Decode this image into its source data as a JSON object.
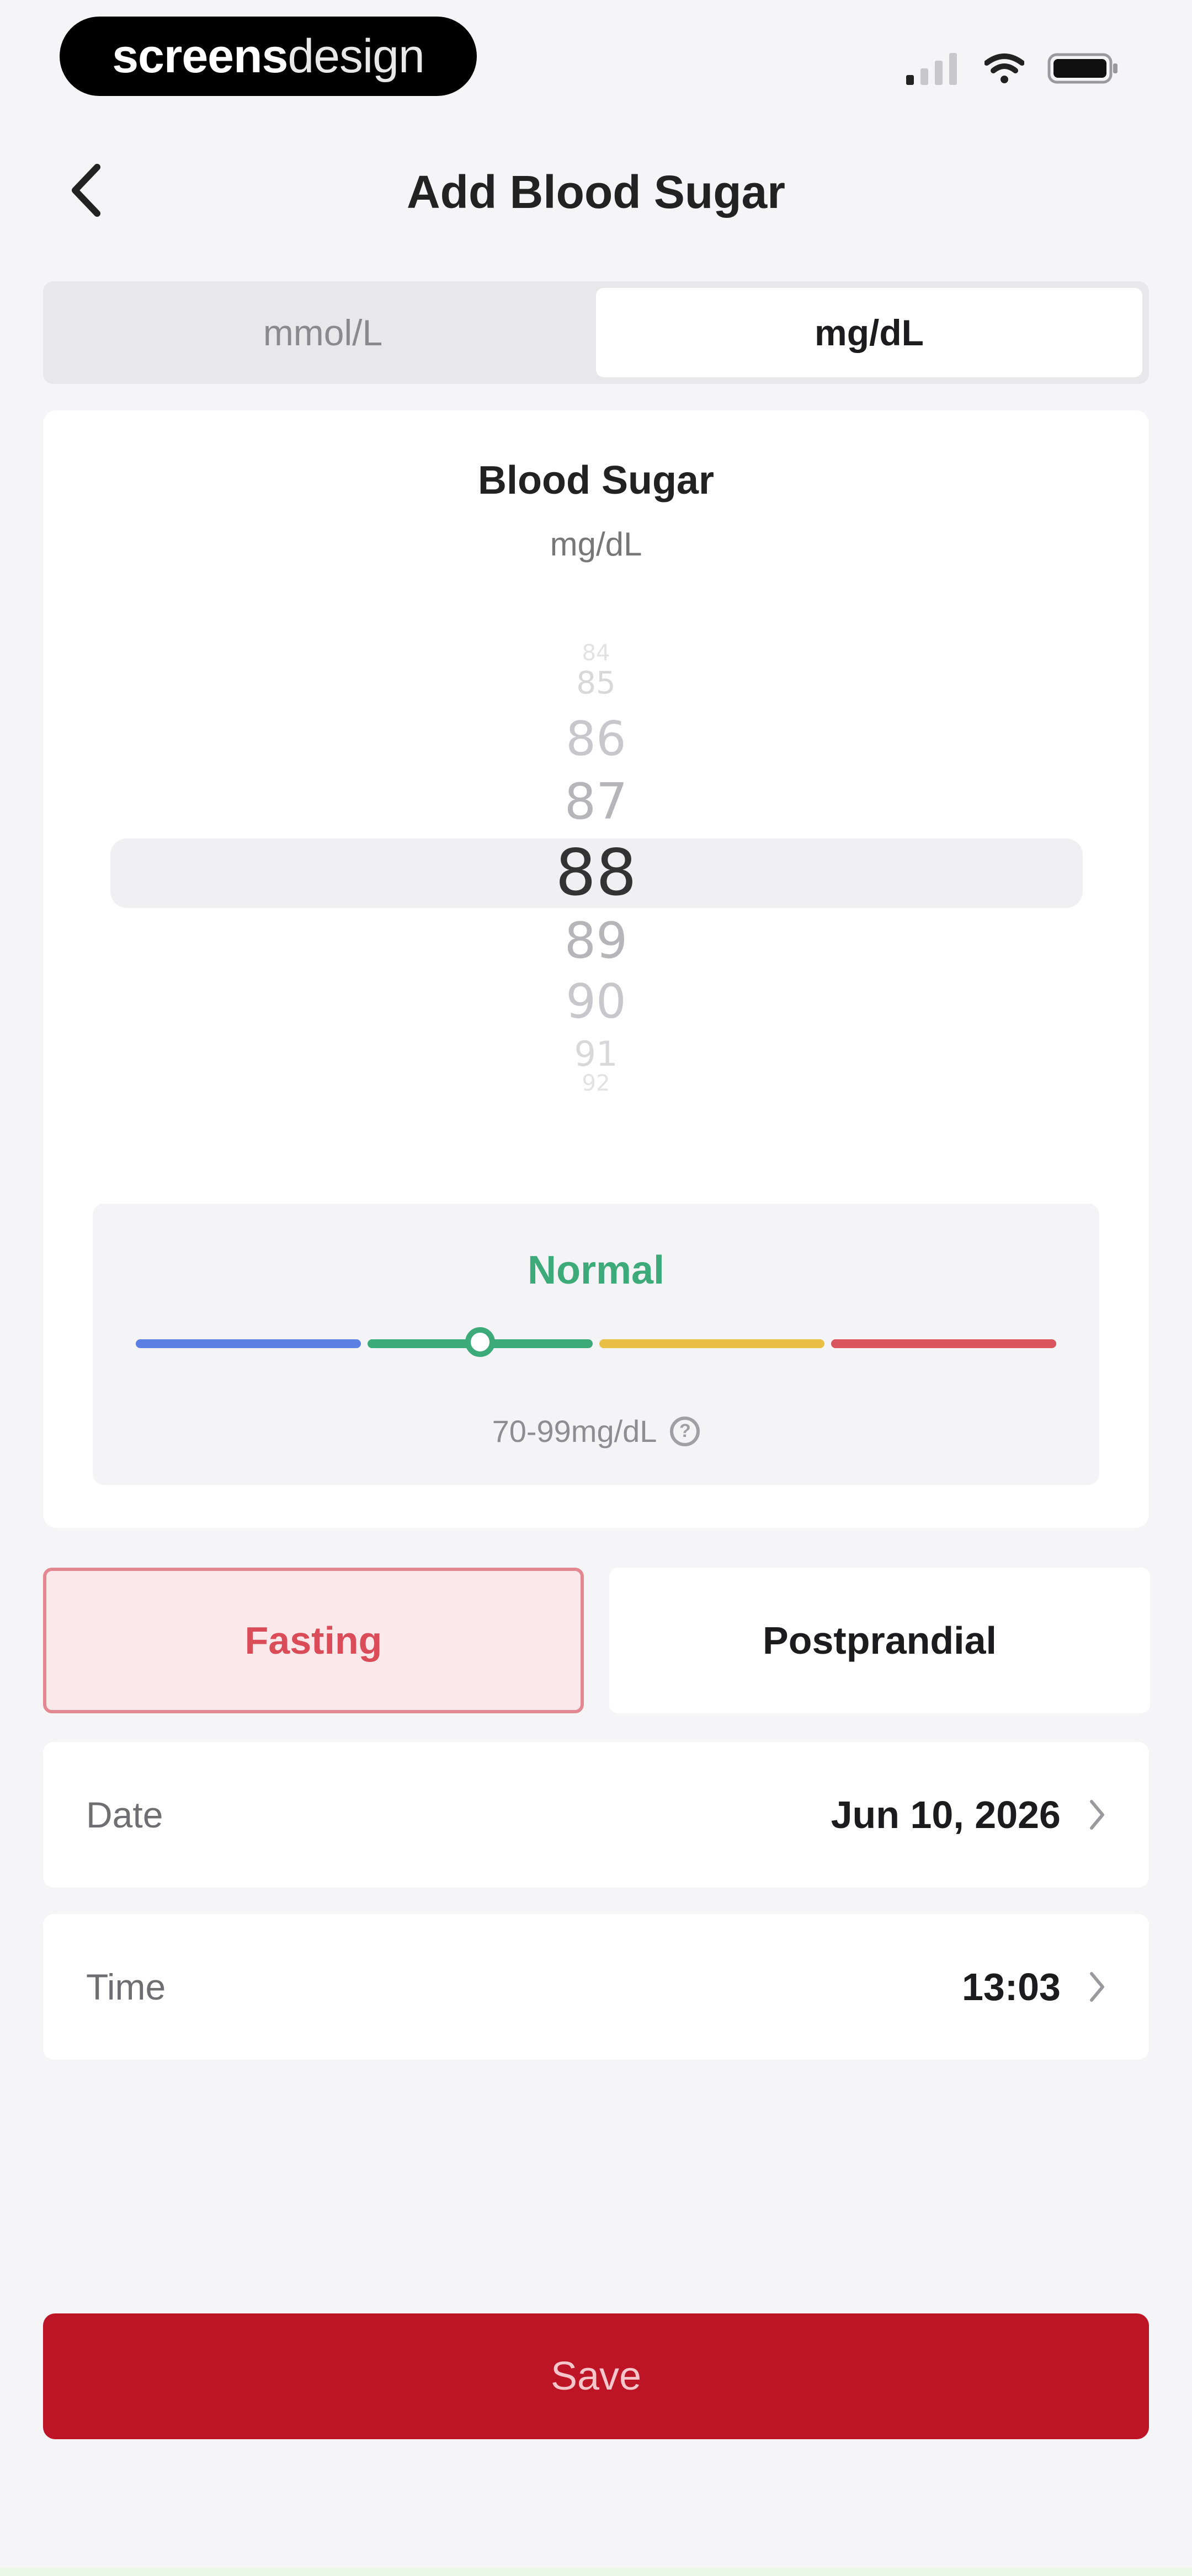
{
  "status_bar": {
    "brand_bold": "screens",
    "brand_light": "design",
    "icons": [
      "signal-icon",
      "wifi-icon",
      "battery-icon"
    ]
  },
  "nav": {
    "back_icon": "chevron-left-icon",
    "title": "Add Blood Sugar"
  },
  "unit_toggle": {
    "options": [
      "mmol/L",
      "mg/dL"
    ],
    "selected": "mg/dL"
  },
  "picker": {
    "title": "Blood Sugar",
    "unit": "mg/dL",
    "values_above": [
      "84",
      "85",
      "86",
      "87"
    ],
    "selected": "88",
    "values_below": [
      "89",
      "90",
      "91",
      "92"
    ]
  },
  "status": {
    "label": "Normal",
    "range": "70-99mg/dL",
    "info_icon": "info-icon",
    "scale_colors": [
      "#5b7fe3",
      "#3daa7a",
      "#e9bf45",
      "#d9545c"
    ],
    "accent_color": "#3daa7a"
  },
  "meal_timing": {
    "options": [
      "Fasting",
      "Postprandial"
    ],
    "selected": "Fasting"
  },
  "date_row": {
    "label": "Date",
    "value": "Jun 10, 2026",
    "icon": "chevron-right-icon"
  },
  "time_row": {
    "label": "Time",
    "value": "13:03",
    "icon": "chevron-right-icon"
  },
  "save": {
    "label": "Save",
    "color": "#bd1426"
  }
}
